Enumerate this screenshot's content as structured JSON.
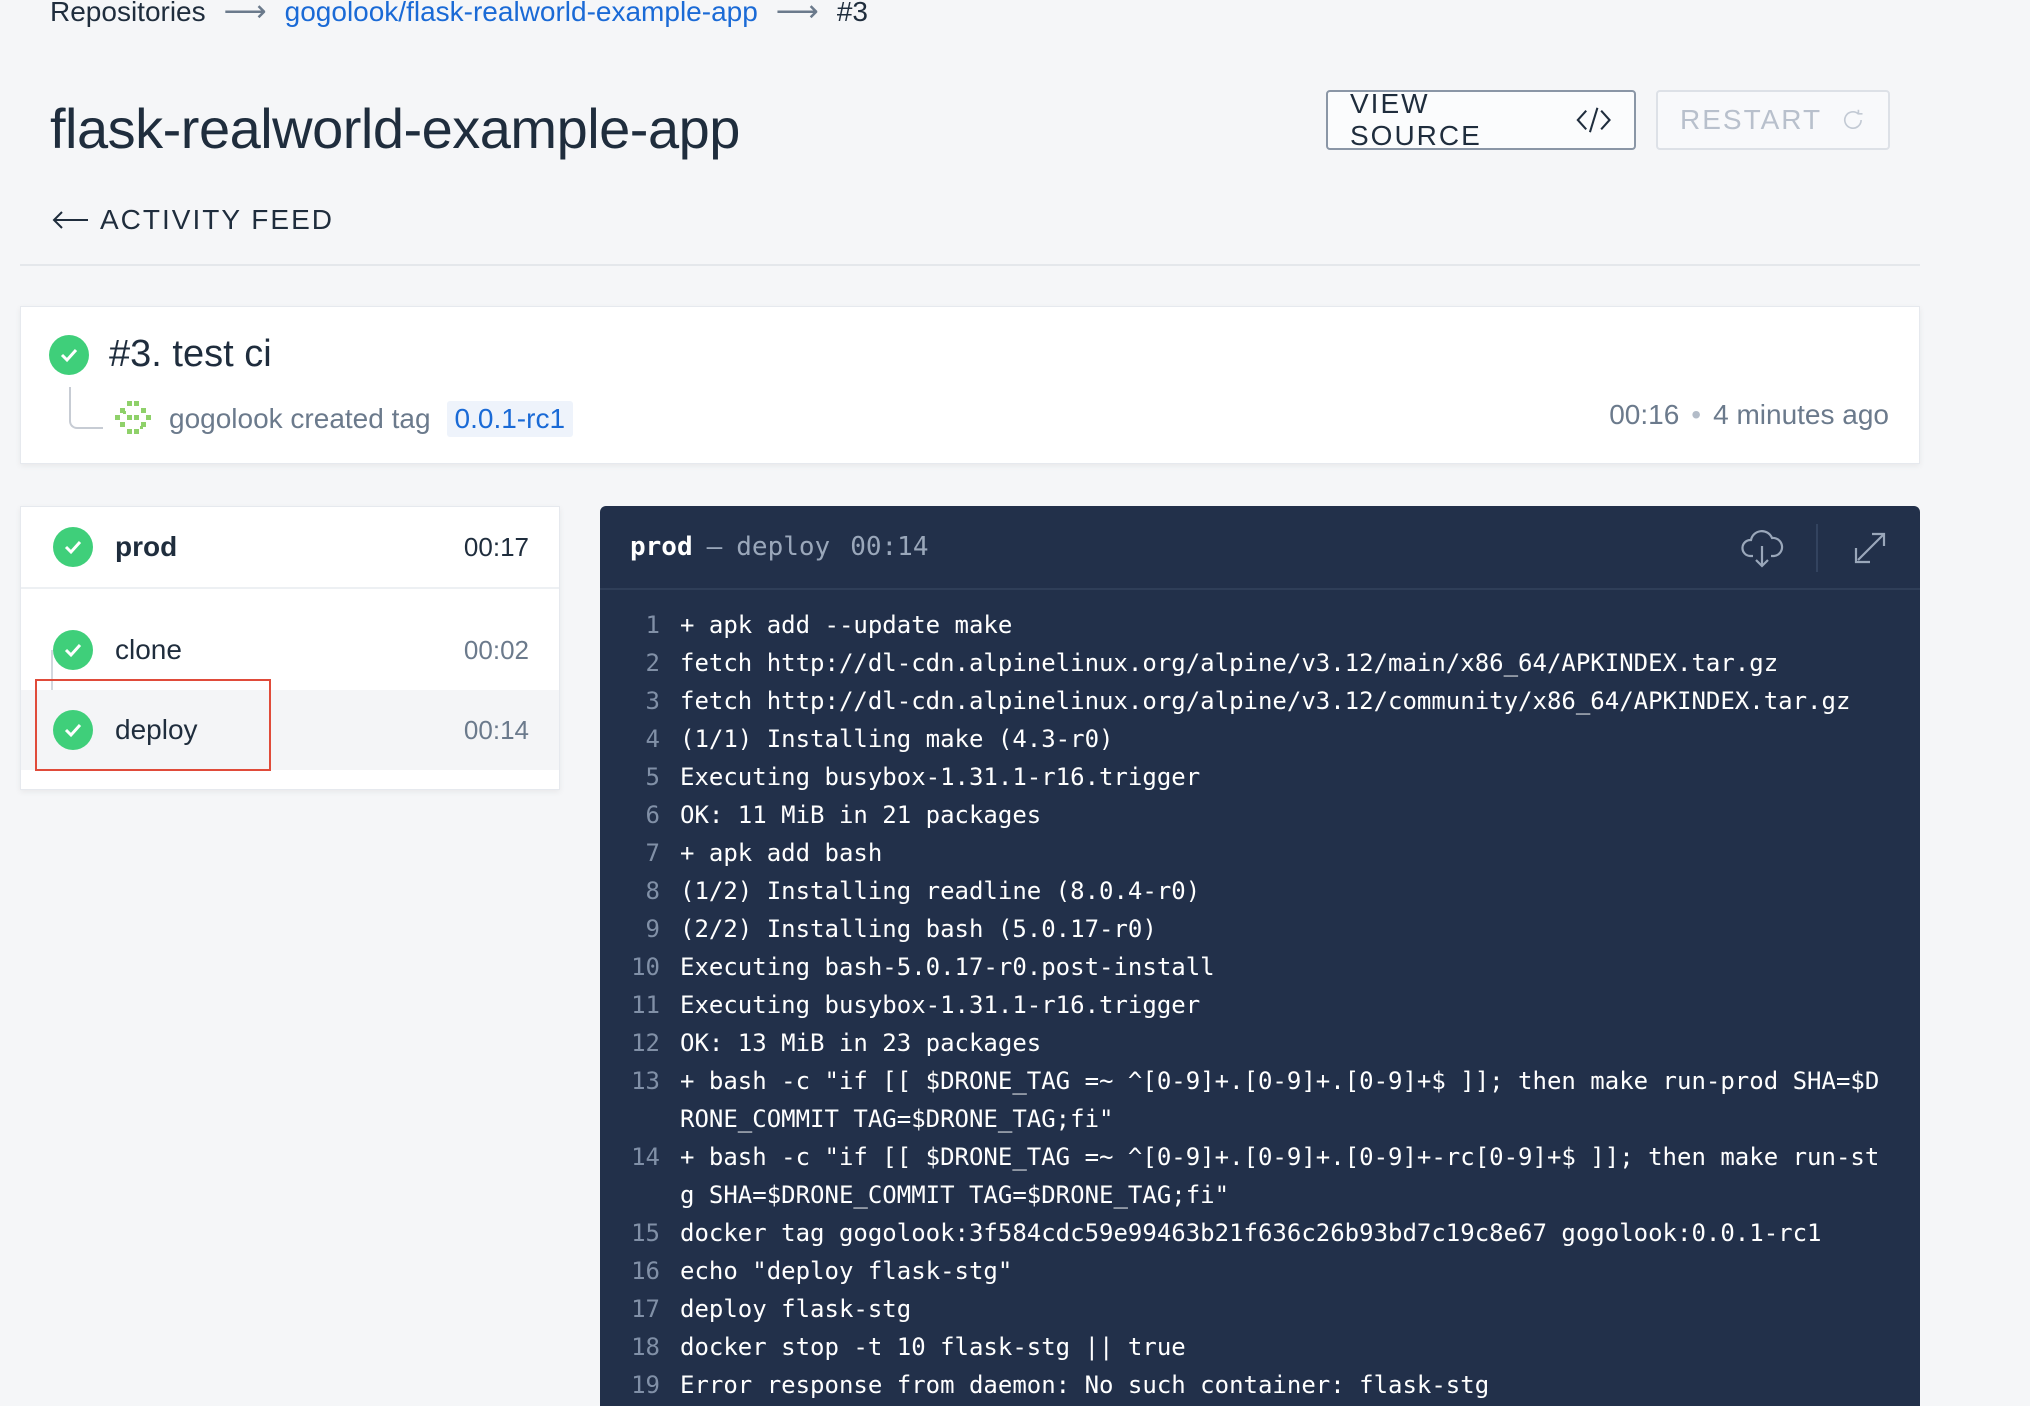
{
  "breadcrumb": {
    "root": "Repositories",
    "repo": "gogolook/flask-realworld-example-app",
    "build": "#3"
  },
  "page_title": "flask-realworld-example-app",
  "actions": {
    "view_source": "VIEW SOURCE",
    "restart": "RESTART"
  },
  "activity_feed": "ACTIVITY FEED",
  "build": {
    "title": "#3. test ci",
    "author_text": "gogolook created tag",
    "tag": "0.0.1-rc1",
    "duration": "00:16",
    "ago": "4 minutes ago",
    "status": "success",
    "status_color": "#3fcf7a"
  },
  "stage": {
    "name": "prod",
    "duration": "00:17",
    "steps": [
      {
        "name": "clone",
        "duration": "00:02"
      },
      {
        "name": "deploy",
        "duration": "00:14"
      }
    ]
  },
  "log": {
    "stage": "prod",
    "step": "deploy",
    "duration": "00:14",
    "lines": [
      {
        "n": "1",
        "text": "+ apk add --update make"
      },
      {
        "n": "2",
        "text": "fetch http://dl-cdn.alpinelinux.org/alpine/v3.12/main/x86_64/APKINDEX.tar.gz"
      },
      {
        "n": "3",
        "text": "fetch http://dl-cdn.alpinelinux.org/alpine/v3.12/community/x86_64/APKINDEX.tar.gz"
      },
      {
        "n": "4",
        "text": "(1/1) Installing make (4.3-r0)"
      },
      {
        "n": "5",
        "text": "Executing busybox-1.31.1-r16.trigger"
      },
      {
        "n": "6",
        "text": "OK: 11 MiB in 21 packages"
      },
      {
        "n": "7",
        "text": "+ apk add bash"
      },
      {
        "n": "8",
        "text": "(1/2) Installing readline (8.0.4-r0)"
      },
      {
        "n": "9",
        "text": "(2/2) Installing bash (5.0.17-r0)"
      },
      {
        "n": "10",
        "text": "Executing bash-5.0.17-r0.post-install"
      },
      {
        "n": "11",
        "text": "Executing busybox-1.31.1-r16.trigger"
      },
      {
        "n": "12",
        "text": "OK: 13 MiB in 23 packages"
      },
      {
        "n": "13",
        "text": "+ bash -c \"if [[ $DRONE_TAG =~ ^[0-9]+.[0-9]+.[0-9]+$ ]]; then make run-prod SHA=$DRONE_COMMIT TAG=$DRONE_TAG;fi\""
      },
      {
        "n": "14",
        "text": "+ bash -c \"if [[ $DRONE_TAG =~ ^[0-9]+.[0-9]+.[0-9]+-rc[0-9]+$ ]]; then make run-stg SHA=$DRONE_COMMIT TAG=$DRONE_TAG;fi\""
      },
      {
        "n": "15",
        "text": "docker tag gogolook:3f584cdc59e99463b21f636c26b93bd7c19c8e67 gogolook:0.0.1-rc1"
      },
      {
        "n": "16",
        "text": "echo \"deploy flask-stg\""
      },
      {
        "n": "17",
        "text": "deploy flask-stg"
      },
      {
        "n": "18",
        "text": "docker stop -t 10 flask-stg || true"
      },
      {
        "n": "19",
        "text": "Error response from daemon: No such container: flask-stg"
      }
    ]
  }
}
